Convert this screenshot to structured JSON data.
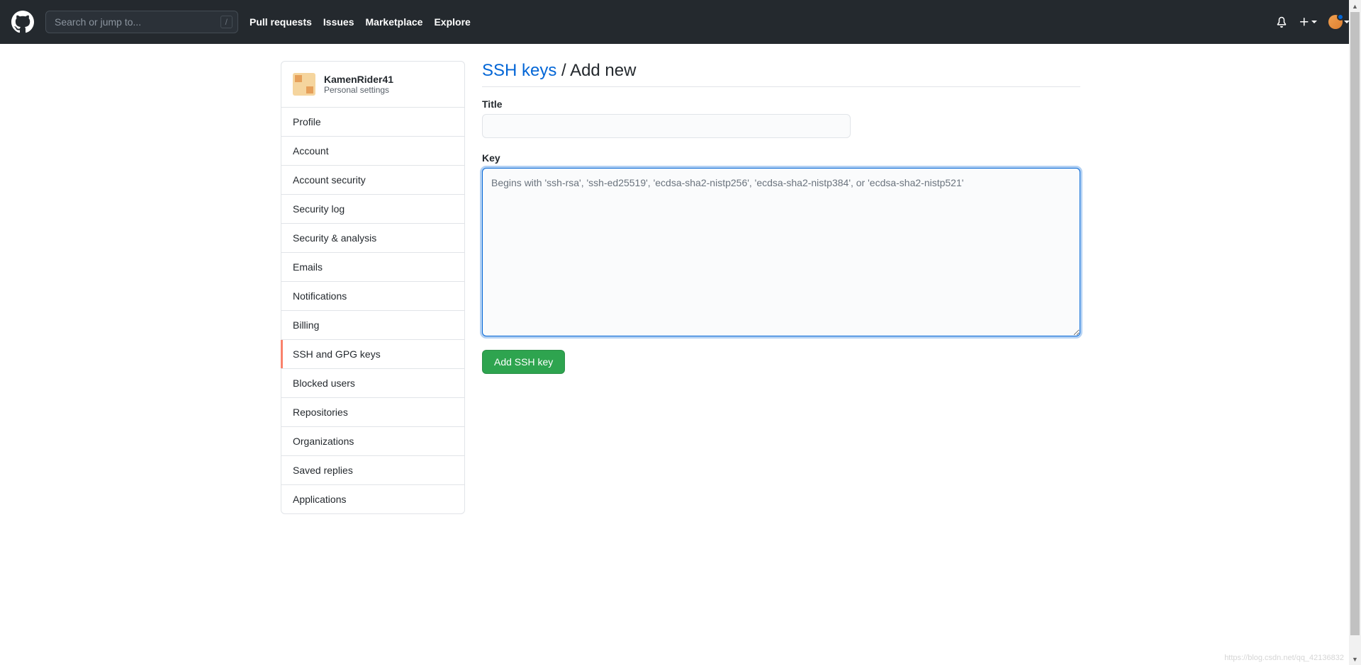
{
  "header": {
    "search_placeholder": "Search or jump to...",
    "search_shortcut": "/",
    "nav": {
      "pull_requests": "Pull requests",
      "issues": "Issues",
      "marketplace": "Marketplace",
      "explore": "Explore"
    }
  },
  "sidebar": {
    "username": "KamenRider41",
    "subtitle": "Personal settings",
    "items": [
      {
        "label": "Profile"
      },
      {
        "label": "Account"
      },
      {
        "label": "Account security"
      },
      {
        "label": "Security log"
      },
      {
        "label": "Security & analysis"
      },
      {
        "label": "Emails"
      },
      {
        "label": "Notifications"
      },
      {
        "label": "Billing"
      },
      {
        "label": "SSH and GPG keys"
      },
      {
        "label": "Blocked users"
      },
      {
        "label": "Repositories"
      },
      {
        "label": "Organizations"
      },
      {
        "label": "Saved replies"
      },
      {
        "label": "Applications"
      }
    ]
  },
  "page": {
    "title_link": "SSH keys",
    "title_separator": " / ",
    "title_sub": "Add new",
    "form": {
      "title_label": "Title",
      "title_value": "",
      "key_label": "Key",
      "key_placeholder": "Begins with 'ssh-rsa', 'ssh-ed25519', 'ecdsa-sha2-nistp256', 'ecdsa-sha2-nistp384', or 'ecdsa-sha2-nistp521'",
      "key_value": "",
      "submit_label": "Add SSH key"
    }
  },
  "watermark": "https://blog.csdn.net/qq_42136832"
}
